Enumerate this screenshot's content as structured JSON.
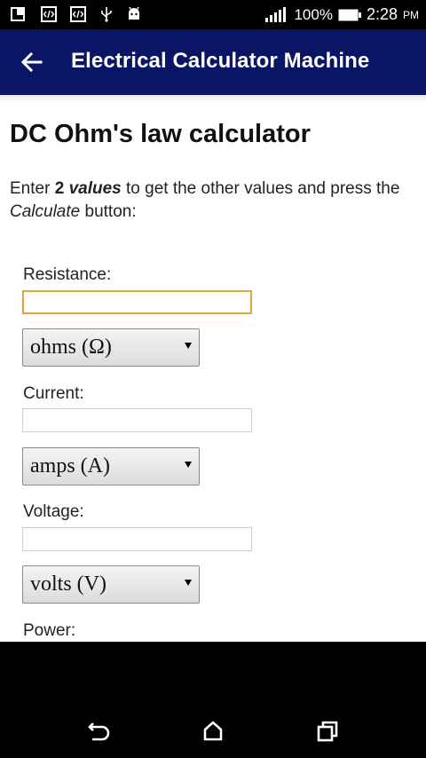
{
  "status_bar": {
    "battery": "100%",
    "time": "2:28",
    "ampm": "PM",
    "icons": [
      "window-icon",
      "code-icon",
      "code-icon",
      "usb-icon",
      "android-icon",
      "signal-icon",
      "battery-icon"
    ]
  },
  "app_bar": {
    "title": "Electrical Calculator Machine",
    "back_icon": "back-arrow-icon"
  },
  "page": {
    "title": "DC Ohm's law calculator",
    "instructions": {
      "part1": "Enter ",
      "bold_number": "2",
      "bold_italic": "values",
      "part2": " to get the other values and press the ",
      "italic": "Calculate",
      "part3": " button:"
    }
  },
  "form": {
    "resistance": {
      "label": "Resistance:",
      "value": "",
      "unit": "ohms (Ω)"
    },
    "current": {
      "label": "Current:",
      "value": "",
      "unit": "amps (A)"
    },
    "voltage": {
      "label": "Voltage:",
      "value": "",
      "unit": "volts (V)"
    },
    "power": {
      "label": "Power:"
    }
  },
  "nav_bar": {
    "icons": [
      "back-icon",
      "home-icon",
      "recents-icon"
    ]
  }
}
